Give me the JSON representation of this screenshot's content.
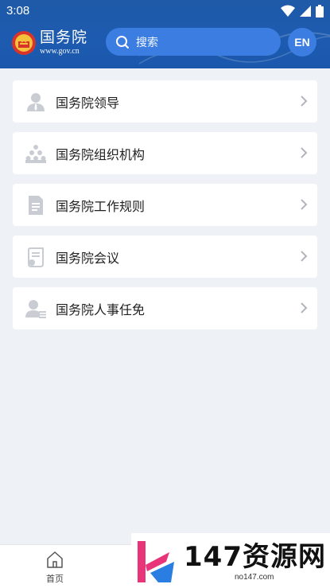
{
  "status_bar": {
    "time": "3:08"
  },
  "header": {
    "logo_title": "国务院",
    "logo_subtitle": "www.gov.cn",
    "search_placeholder": "搜索",
    "language_button": "EN"
  },
  "menu": {
    "items": [
      {
        "label": "国务院领导",
        "icon": "person-icon"
      },
      {
        "label": "国务院组织机构",
        "icon": "organization-icon"
      },
      {
        "label": "国务院工作规则",
        "icon": "document-icon"
      },
      {
        "label": "国务院会议",
        "icon": "meeting-scroll-icon"
      },
      {
        "label": "国务院人事任免",
        "icon": "personnel-icon"
      }
    ]
  },
  "bottom_nav": {
    "home_label": "首页"
  },
  "watermark": {
    "brand": "147资源网",
    "url": "no147.com"
  },
  "colors": {
    "header_bg": "#1d5bb0",
    "search_bg": "#3b7de0",
    "page_bg": "#eef1f5",
    "icon_gray": "#c9cdd3"
  }
}
